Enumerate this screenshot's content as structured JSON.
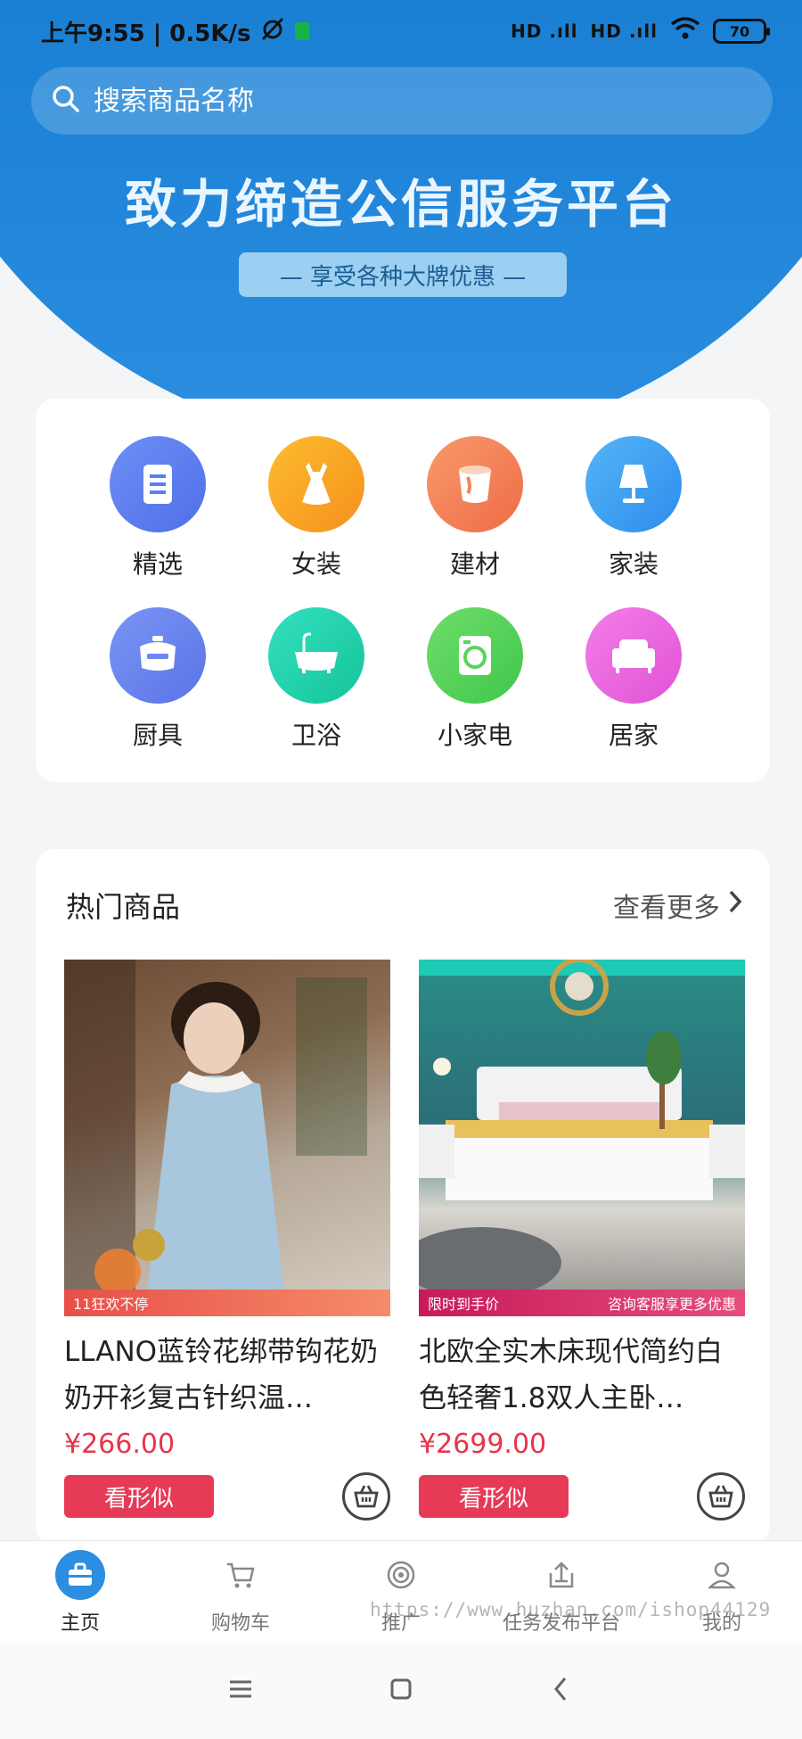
{
  "status_bar": {
    "time": "上午9:55 | 0.5K/s",
    "signal_1": "HD .ıll",
    "signal_2": "HD .ıll",
    "battery": "70",
    "colors": {
      "sim_icon": "#16b34a"
    }
  },
  "search": {
    "placeholder": "搜索商品名称"
  },
  "hero": {
    "title": "致力缔造公信服务平台",
    "subtitle": "— 享受各种大牌优惠 —",
    "colors": {
      "background": "#1a80d4"
    }
  },
  "categories": [
    {
      "label": "精选",
      "icon": "list-icon",
      "color": "#5b7ff0"
    },
    {
      "label": "女装",
      "icon": "dress-icon",
      "color": "#f7a623"
    },
    {
      "label": "建材",
      "icon": "paint-bucket-icon",
      "color": "#f5835a"
    },
    {
      "label": "家装",
      "icon": "lamp-icon",
      "color": "#3b9ff0"
    },
    {
      "label": "厨具",
      "icon": "rice-cooker-icon",
      "color": "#6c86f2"
    },
    {
      "label": "卫浴",
      "icon": "bathtub-icon",
      "color": "#22d4b0"
    },
    {
      "label": "小家电",
      "icon": "washing-machine-icon",
      "color": "#58d45a"
    },
    {
      "label": "居家",
      "icon": "sofa-icon",
      "color": "#ee6be0"
    }
  ],
  "hot": {
    "title": "热门商品",
    "more": "查看更多",
    "products": [
      {
        "name": "LLANO蓝铃花绑带钩花奶奶开衫复古针织温…",
        "price": "¥266.00",
        "tag": "11狂欢不停",
        "button": "看形似",
        "image": "woman-cardigan-photo"
      },
      {
        "name": "北欧全实木床现代简约白色轻奢1.8双人主卧…",
        "price": "¥2699.00",
        "tag": "限时到手价",
        "tag_right": "咨询客服享更多优惠",
        "button": "看形似",
        "image": "white-bed-photo"
      }
    ],
    "colors": {
      "price": "#e8344a",
      "button": "#e73a57"
    }
  },
  "tabbar": {
    "items": [
      {
        "label": "主页",
        "icon": "briefcase-icon",
        "active": true
      },
      {
        "label": "购物车",
        "icon": "cart-icon",
        "active": false
      },
      {
        "label": "推广",
        "icon": "target-icon",
        "active": false
      },
      {
        "label": "任务发布平台",
        "icon": "upload-icon",
        "active": false
      },
      {
        "label": "我的",
        "icon": "user-icon",
        "active": false
      }
    ],
    "colors": {
      "active": "#2b8ee0"
    }
  },
  "watermark": "https://www.huzhan.com/ishop44129"
}
